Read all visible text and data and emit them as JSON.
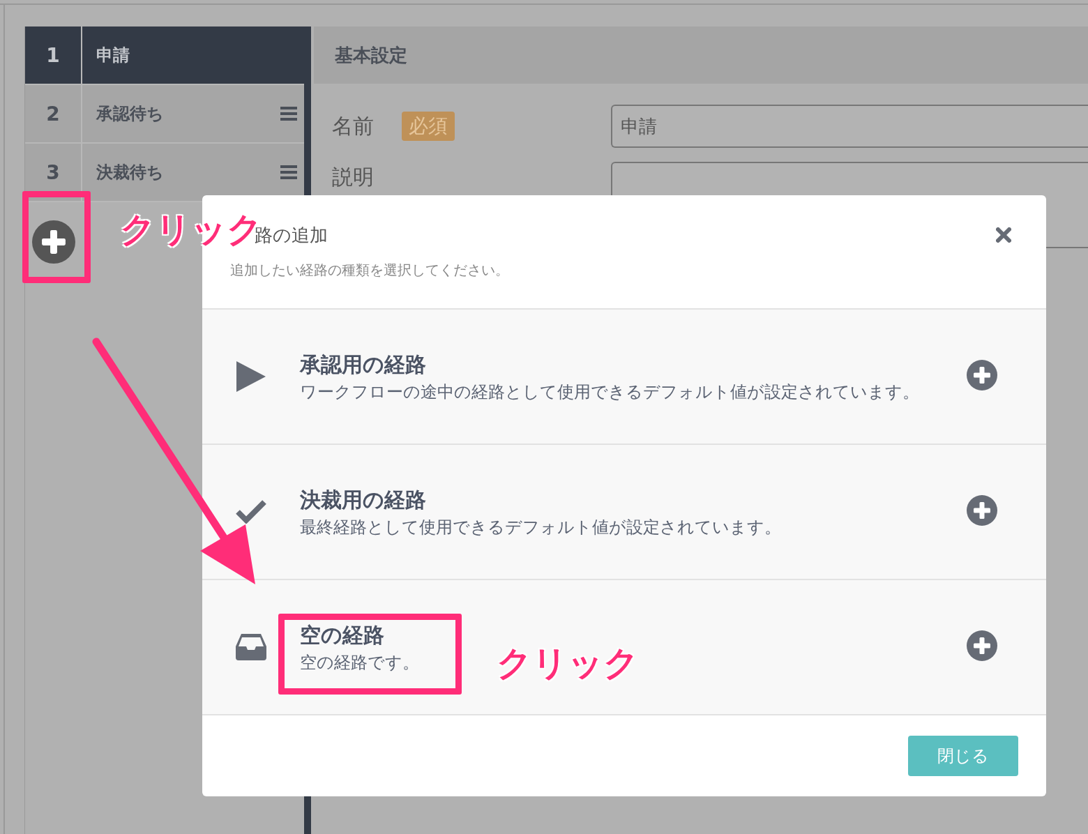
{
  "sidebar": {
    "steps": [
      {
        "number": "1",
        "name": "申請",
        "selected": true
      },
      {
        "number": "2",
        "name": "承認待ち",
        "selected": false
      },
      {
        "number": "3",
        "name": "決裁待ち",
        "selected": false
      }
    ]
  },
  "main": {
    "section_title": "基本設定",
    "fields": [
      {
        "label": "名前",
        "badge": "必須",
        "value": "申請"
      },
      {
        "label": "説明"
      }
    ]
  },
  "modal": {
    "title": "路の追加",
    "subtitle": "追加したい経路の種類を選択してください。",
    "options": [
      {
        "kind": "play",
        "title": "承認用の経路",
        "description": "ワークフローの途中の経路として使用できるデフォルト値が設定されています。"
      },
      {
        "kind": "check",
        "title": "決裁用の経路",
        "description": "最終経路として使用できるデフォルト値が設定されています。"
      },
      {
        "kind": "inbox",
        "title": "空の経路",
        "description": "空の経路です。"
      }
    ],
    "close_button": "閉じる"
  },
  "annotations": [
    {
      "kind": "callout",
      "text": "クリック"
    },
    {
      "kind": "callout",
      "text": "クリック"
    }
  ]
}
